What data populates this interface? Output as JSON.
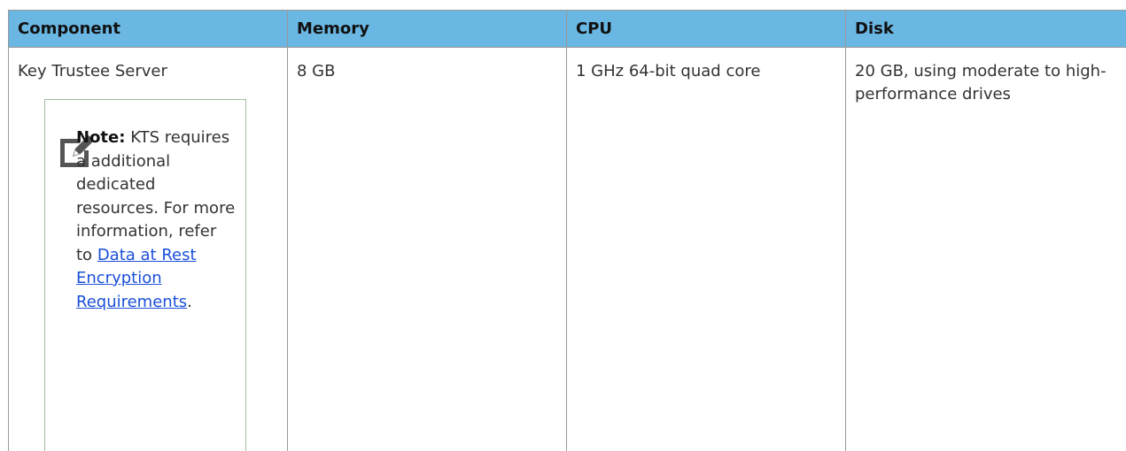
{
  "table": {
    "headers": [
      "Component",
      "Memory",
      "CPU",
      "Disk"
    ],
    "rows": [
      {
        "component": "Key Trustee Server",
        "memory": "8 GB",
        "cpu": "1 GHz 64-bit quad core",
        "disk": "20 GB, using moderate to high-performance drives",
        "note": {
          "label": "Note:",
          "text_before_link": "KTS requires a additional dedicated resources. For more information, refer to",
          "link_text": "Data at Rest Encryption Requirements",
          "text_after_link": ".",
          "icon": "note-edit-icon"
        }
      }
    ]
  },
  "colors": {
    "header_background": "#6ab7e3",
    "border": "#999999",
    "note_border": "#9dbf9d",
    "link": "#1a4fd8"
  }
}
